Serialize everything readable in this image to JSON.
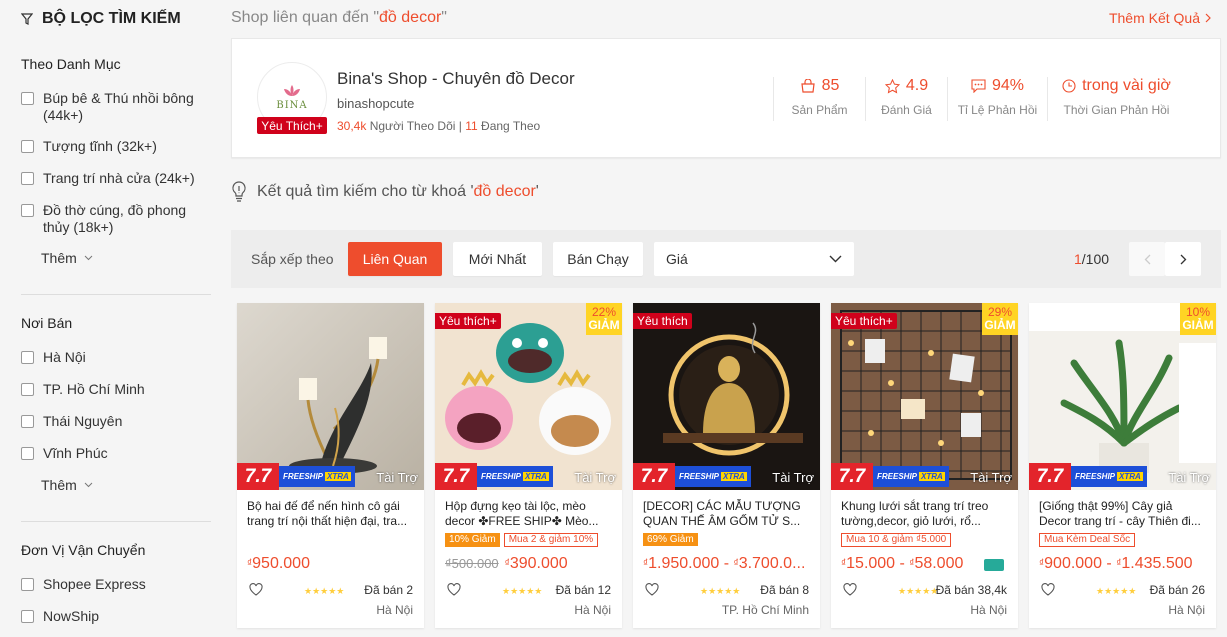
{
  "filter": {
    "title": "BỘ LỌC TÌM KIẾM",
    "category": {
      "title": "Theo Danh Mục",
      "items": [
        {
          "label": "Búp bê & Thú nhồi bông (44k+)"
        },
        {
          "label": "Tượng tĩnh (32k+)"
        },
        {
          "label": "Trang trí nhà cửa (24k+)"
        },
        {
          "label": "Đồ thờ cúng, đồ phong thủy (18k+)"
        }
      ],
      "more": "Thêm"
    },
    "location": {
      "title": "Nơi Bán",
      "items": [
        {
          "label": "Hà Nội"
        },
        {
          "label": "TP. Hồ Chí Minh"
        },
        {
          "label": "Thái Nguyên"
        },
        {
          "label": "Vĩnh Phúc"
        }
      ],
      "more": "Thêm"
    },
    "shipping": {
      "title": "Đơn Vị Vận Chuyển",
      "items": [
        {
          "label": "Shopee Express"
        },
        {
          "label": "NowShip"
        }
      ]
    }
  },
  "shop_section": {
    "prefix": "Shop liên quan đến \"",
    "keyword": "đồ decor",
    "suffix": "\"",
    "more": "Thêm Kết Quả"
  },
  "shop": {
    "logo_text": "BINA",
    "badge": "Yêu Thích+",
    "name": "Bina's Shop - Chuyên đồ Decor",
    "username": "binashopcute",
    "followers": "30,4k",
    "followers_label": "Người Theo Dõi |",
    "following": "11",
    "following_label": "Đang Theo",
    "stats": [
      {
        "value": "85",
        "label": "Sản Phẩm",
        "icon": "shop-bag-icon"
      },
      {
        "value": "4.9",
        "label": "Đánh Giá",
        "icon": "star-outline-icon"
      },
      {
        "value": "94%",
        "label": "Tỉ Lệ Phản Hồi",
        "icon": "chat-icon"
      },
      {
        "value": "trong vài giờ",
        "label": "Thời Gian Phản Hồi",
        "icon": "clock-icon"
      }
    ]
  },
  "keyword_result": {
    "prefix": "Kết quả tìm kiếm cho từ khoá '",
    "keyword": "đồ decor",
    "suffix": "'"
  },
  "sort": {
    "label": "Sắp xếp theo",
    "options": [
      "Liên Quan",
      "Mới Nhất",
      "Bán Chạy"
    ],
    "price": "Giá",
    "page_current": "1",
    "page_total": "/100"
  },
  "products": [
    {
      "name": "Bộ hai đế để nến hình cô gái trang trí nội thất hiện đại, tra...",
      "price": "950.000",
      "old_price": "",
      "price_max": "",
      "tag": "",
      "discount_pct": "",
      "discount_label": "",
      "badges": [],
      "sold": "Đã bán 2",
      "location": "Hà Nội",
      "sponsor": "Tài Trợ",
      "s77": "7.7",
      "freeship": "FREESHIP",
      "xtra": "XTRA"
    },
    {
      "name": "Hộp đựng kẹo tài lộc, mèo decor ✤FREE SHIP✤ Mèo...",
      "price": "390.000",
      "old_price": "₫500.000",
      "price_max": "",
      "tag": "Yêu thích+",
      "discount_pct": "22%",
      "discount_label": "GIẢM",
      "badges": [
        {
          "type": "orange",
          "text": "10% Giảm"
        },
        {
          "type": "outline",
          "text": "Mua 2 & giảm 10%"
        }
      ],
      "sold": "Đã bán 12",
      "location": "Hà Nội",
      "sponsor": "Tài Trợ",
      "s77": "7.7",
      "freeship": "FREESHIP",
      "xtra": "XTRA"
    },
    {
      "name": "[DECOR] CÁC MẪU TƯỢNG QUAN THẾ ÂM GỐM TỬ S...",
      "price": "1.950.000",
      "old_price": "",
      "price_max": "3.700.0...",
      "tag": "Yêu thích",
      "discount_pct": "",
      "discount_label": "",
      "badges": [
        {
          "type": "orange",
          "text": "69% Giảm"
        }
      ],
      "sold": "Đã bán 8",
      "location": "TP. Hồ Chí Minh",
      "sponsor": "Tài Trợ",
      "s77": "7.7",
      "freeship": "FREESHIP",
      "xtra": "XTRA"
    },
    {
      "name": "Khung lưới sắt trang trí treo tường,decor, giỏ lưới, rổ...",
      "price": "15.000",
      "old_price": "",
      "price_max": "58.000",
      "tag": "Yêu thích+",
      "discount_pct": "29%",
      "discount_label": "GIẢM",
      "badges": [
        {
          "type": "outline",
          "text": "Mua 10 & giảm ₫5.000"
        }
      ],
      "sold": "Đã bán 38,4k",
      "location": "Hà Nội",
      "sponsor": "Tài Trợ",
      "s77": "7.7",
      "freeship": "FREESHIP",
      "xtra": "XTRA"
    },
    {
      "name": "[Giống thật 99%] Cây giả Decor trang trí - cây Thiên đi...",
      "price": "900.000",
      "old_price": "",
      "price_max": "1.435.500",
      "tag": "",
      "discount_pct": "10%",
      "discount_label": "GIẢM",
      "badges": [
        {
          "type": "outline",
          "text": "Mua Kèm Deal Sốc"
        }
      ],
      "sold": "Đã bán 26",
      "location": "Hà Nội",
      "sponsor": "Tài Trợ",
      "s77": "7.7",
      "freeship": "FREESHIP",
      "xtra": "XTRA"
    }
  ],
  "currency": "₫",
  "colors": {
    "accent": "#ee4d2d",
    "preferred": "#d0011b",
    "discount_bg": "#ffd424"
  }
}
